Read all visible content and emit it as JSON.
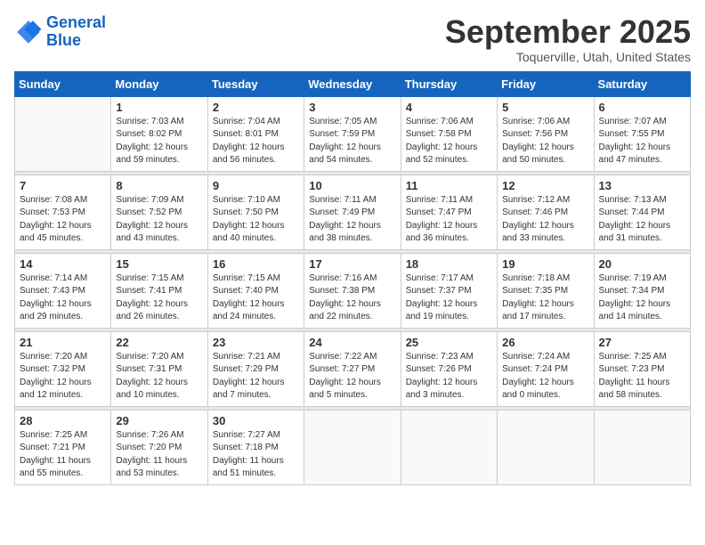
{
  "header": {
    "logo_line1": "General",
    "logo_line2": "Blue",
    "month": "September 2025",
    "location": "Toquerville, Utah, United States"
  },
  "days_of_week": [
    "Sunday",
    "Monday",
    "Tuesday",
    "Wednesday",
    "Thursday",
    "Friday",
    "Saturday"
  ],
  "weeks": [
    [
      {
        "num": "",
        "info": ""
      },
      {
        "num": "1",
        "info": "Sunrise: 7:03 AM\nSunset: 8:02 PM\nDaylight: 12 hours\nand 59 minutes."
      },
      {
        "num": "2",
        "info": "Sunrise: 7:04 AM\nSunset: 8:01 PM\nDaylight: 12 hours\nand 56 minutes."
      },
      {
        "num": "3",
        "info": "Sunrise: 7:05 AM\nSunset: 7:59 PM\nDaylight: 12 hours\nand 54 minutes."
      },
      {
        "num": "4",
        "info": "Sunrise: 7:06 AM\nSunset: 7:58 PM\nDaylight: 12 hours\nand 52 minutes."
      },
      {
        "num": "5",
        "info": "Sunrise: 7:06 AM\nSunset: 7:56 PM\nDaylight: 12 hours\nand 50 minutes."
      },
      {
        "num": "6",
        "info": "Sunrise: 7:07 AM\nSunset: 7:55 PM\nDaylight: 12 hours\nand 47 minutes."
      }
    ],
    [
      {
        "num": "7",
        "info": "Sunrise: 7:08 AM\nSunset: 7:53 PM\nDaylight: 12 hours\nand 45 minutes."
      },
      {
        "num": "8",
        "info": "Sunrise: 7:09 AM\nSunset: 7:52 PM\nDaylight: 12 hours\nand 43 minutes."
      },
      {
        "num": "9",
        "info": "Sunrise: 7:10 AM\nSunset: 7:50 PM\nDaylight: 12 hours\nand 40 minutes."
      },
      {
        "num": "10",
        "info": "Sunrise: 7:11 AM\nSunset: 7:49 PM\nDaylight: 12 hours\nand 38 minutes."
      },
      {
        "num": "11",
        "info": "Sunrise: 7:11 AM\nSunset: 7:47 PM\nDaylight: 12 hours\nand 36 minutes."
      },
      {
        "num": "12",
        "info": "Sunrise: 7:12 AM\nSunset: 7:46 PM\nDaylight: 12 hours\nand 33 minutes."
      },
      {
        "num": "13",
        "info": "Sunrise: 7:13 AM\nSunset: 7:44 PM\nDaylight: 12 hours\nand 31 minutes."
      }
    ],
    [
      {
        "num": "14",
        "info": "Sunrise: 7:14 AM\nSunset: 7:43 PM\nDaylight: 12 hours\nand 29 minutes."
      },
      {
        "num": "15",
        "info": "Sunrise: 7:15 AM\nSunset: 7:41 PM\nDaylight: 12 hours\nand 26 minutes."
      },
      {
        "num": "16",
        "info": "Sunrise: 7:15 AM\nSunset: 7:40 PM\nDaylight: 12 hours\nand 24 minutes."
      },
      {
        "num": "17",
        "info": "Sunrise: 7:16 AM\nSunset: 7:38 PM\nDaylight: 12 hours\nand 22 minutes."
      },
      {
        "num": "18",
        "info": "Sunrise: 7:17 AM\nSunset: 7:37 PM\nDaylight: 12 hours\nand 19 minutes."
      },
      {
        "num": "19",
        "info": "Sunrise: 7:18 AM\nSunset: 7:35 PM\nDaylight: 12 hours\nand 17 minutes."
      },
      {
        "num": "20",
        "info": "Sunrise: 7:19 AM\nSunset: 7:34 PM\nDaylight: 12 hours\nand 14 minutes."
      }
    ],
    [
      {
        "num": "21",
        "info": "Sunrise: 7:20 AM\nSunset: 7:32 PM\nDaylight: 12 hours\nand 12 minutes."
      },
      {
        "num": "22",
        "info": "Sunrise: 7:20 AM\nSunset: 7:31 PM\nDaylight: 12 hours\nand 10 minutes."
      },
      {
        "num": "23",
        "info": "Sunrise: 7:21 AM\nSunset: 7:29 PM\nDaylight: 12 hours\nand 7 minutes."
      },
      {
        "num": "24",
        "info": "Sunrise: 7:22 AM\nSunset: 7:27 PM\nDaylight: 12 hours\nand 5 minutes."
      },
      {
        "num": "25",
        "info": "Sunrise: 7:23 AM\nSunset: 7:26 PM\nDaylight: 12 hours\nand 3 minutes."
      },
      {
        "num": "26",
        "info": "Sunrise: 7:24 AM\nSunset: 7:24 PM\nDaylight: 12 hours\nand 0 minutes."
      },
      {
        "num": "27",
        "info": "Sunrise: 7:25 AM\nSunset: 7:23 PM\nDaylight: 11 hours\nand 58 minutes."
      }
    ],
    [
      {
        "num": "28",
        "info": "Sunrise: 7:25 AM\nSunset: 7:21 PM\nDaylight: 11 hours\nand 55 minutes."
      },
      {
        "num": "29",
        "info": "Sunrise: 7:26 AM\nSunset: 7:20 PM\nDaylight: 11 hours\nand 53 minutes."
      },
      {
        "num": "30",
        "info": "Sunrise: 7:27 AM\nSunset: 7:18 PM\nDaylight: 11 hours\nand 51 minutes."
      },
      {
        "num": "",
        "info": ""
      },
      {
        "num": "",
        "info": ""
      },
      {
        "num": "",
        "info": ""
      },
      {
        "num": "",
        "info": ""
      }
    ]
  ]
}
